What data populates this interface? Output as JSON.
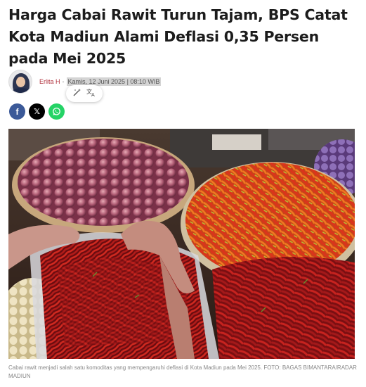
{
  "article": {
    "title": "Harga Cabai Rawit Turun Tajam, BPS Catat Kota Madiun Alami Deflasi 0,35 Persen pada Mei 2025",
    "author": "Erlita H",
    "separator": "-",
    "date": "Kamis, 12 Juni 2025 | 08:10 WIB",
    "caption": "Cabai rawit menjadi salah satu komoditas yang mempengaruhi deflasi di Kota Madiun pada Mei 2025. FOTO: BAGAS BIMANTARA/RADAR MADIUN"
  },
  "selection_popup": {
    "icons": [
      "magic-wand-icon",
      "translate-icon"
    ],
    "wand_glyph": "⚚",
    "translate_glyph": "文A"
  },
  "share": {
    "facebook_glyph": "f",
    "x_glyph": "𝕏",
    "whatsapp_icon": "whatsapp-icon"
  },
  "colors": {
    "author": "#b0303c",
    "facebook": "#3b5998",
    "x": "#000000",
    "whatsapp": "#25d366"
  }
}
